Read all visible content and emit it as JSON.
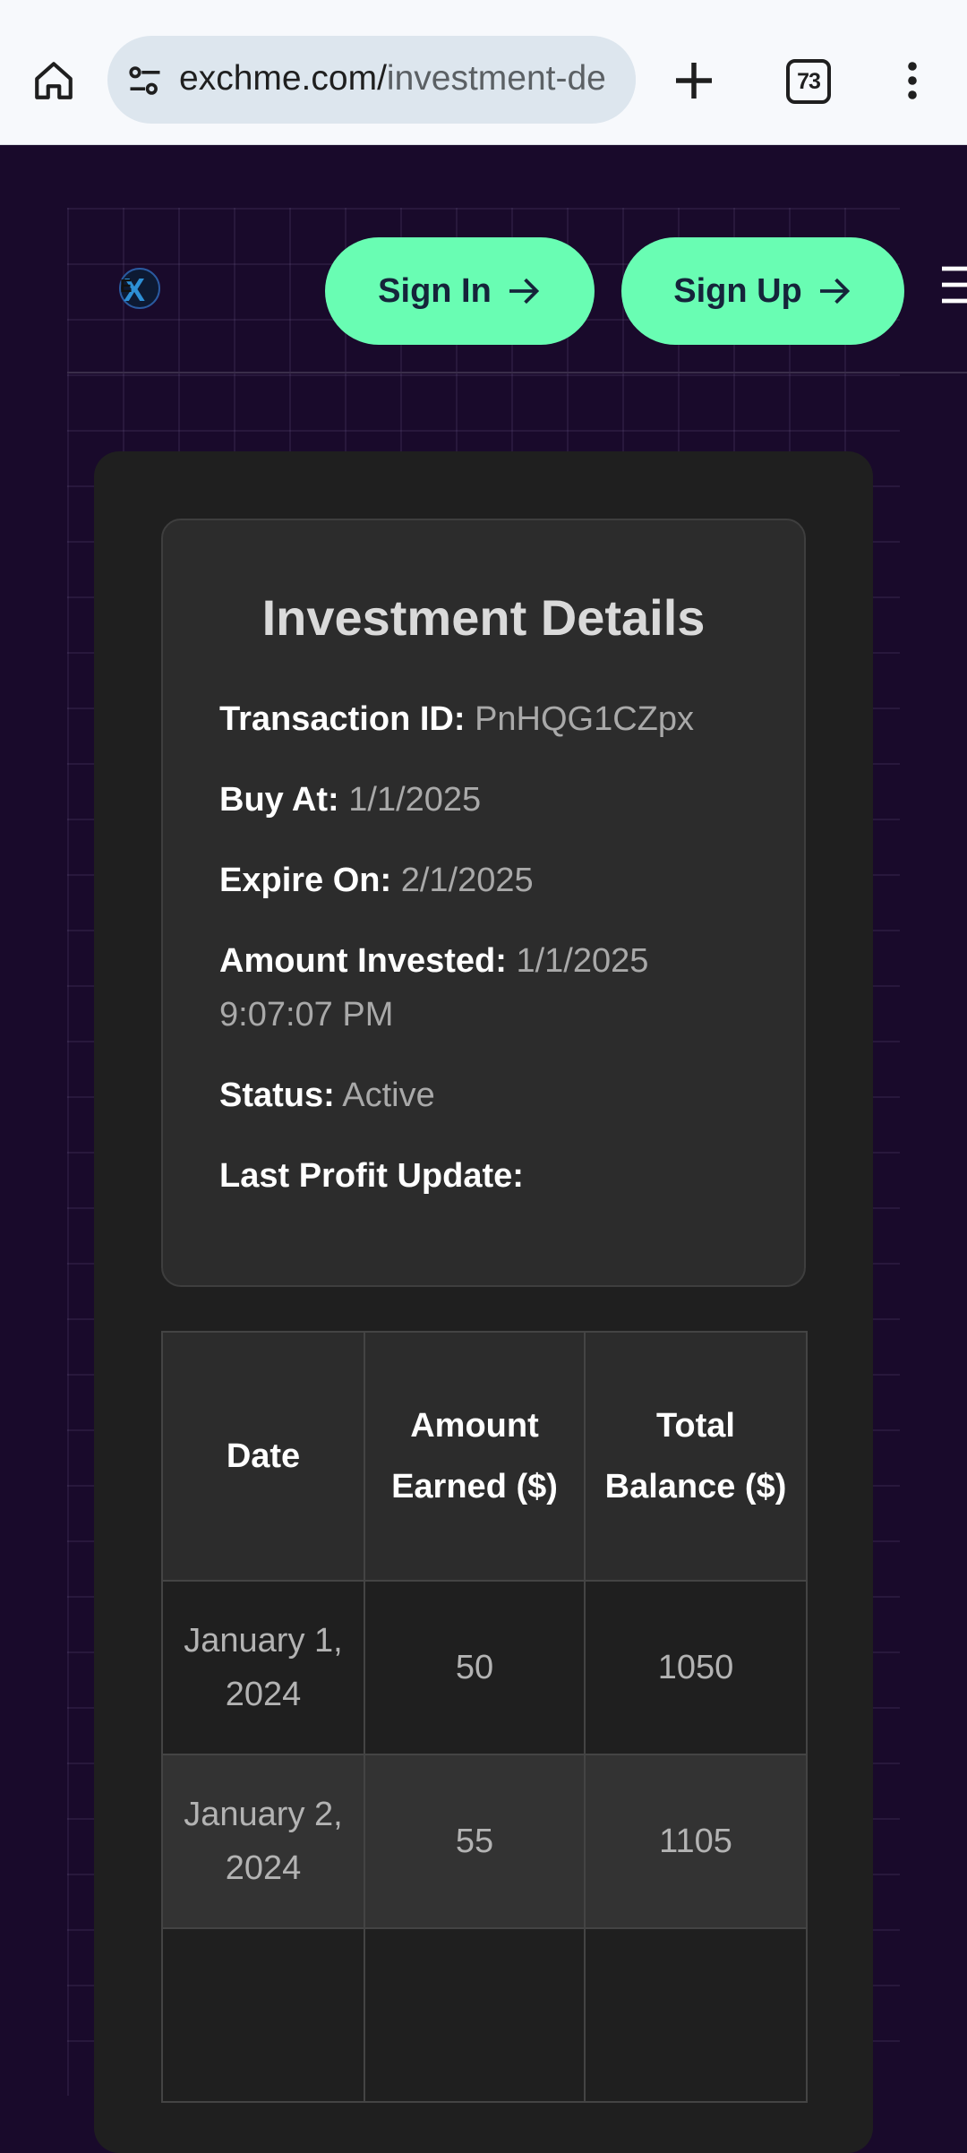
{
  "browser": {
    "url_host": "exchme.com/",
    "url_path": "investment-de",
    "tab_count": "73"
  },
  "nav": {
    "sign_in": "Sign In",
    "sign_up": "Sign Up"
  },
  "details": {
    "title": "Investment Details",
    "fields": [
      {
        "label": "Transaction ID:",
        "value": "PnHQG1CZpx"
      },
      {
        "label": "Buy At:",
        "value": "1/1/2025"
      },
      {
        "label": "Expire On:",
        "value": "2/1/2025"
      },
      {
        "label": "Amount Invested:",
        "value": "1/1/2025 9:07:07 PM"
      },
      {
        "label": "Status:",
        "value": "Active"
      },
      {
        "label": "Last Profit Update:",
        "value": ""
      }
    ]
  },
  "table": {
    "headers": [
      "Date",
      "Amount Earned ($)",
      "Total Balance ($)"
    ],
    "rows": [
      [
        "January 1, 2024",
        "50",
        "1050"
      ],
      [
        "January 2, 2024",
        "55",
        "1105"
      ]
    ]
  },
  "colors": {
    "accent": "#69fdb3",
    "page_bg": "#190a2b",
    "card_bg": "#1f1f1f"
  }
}
